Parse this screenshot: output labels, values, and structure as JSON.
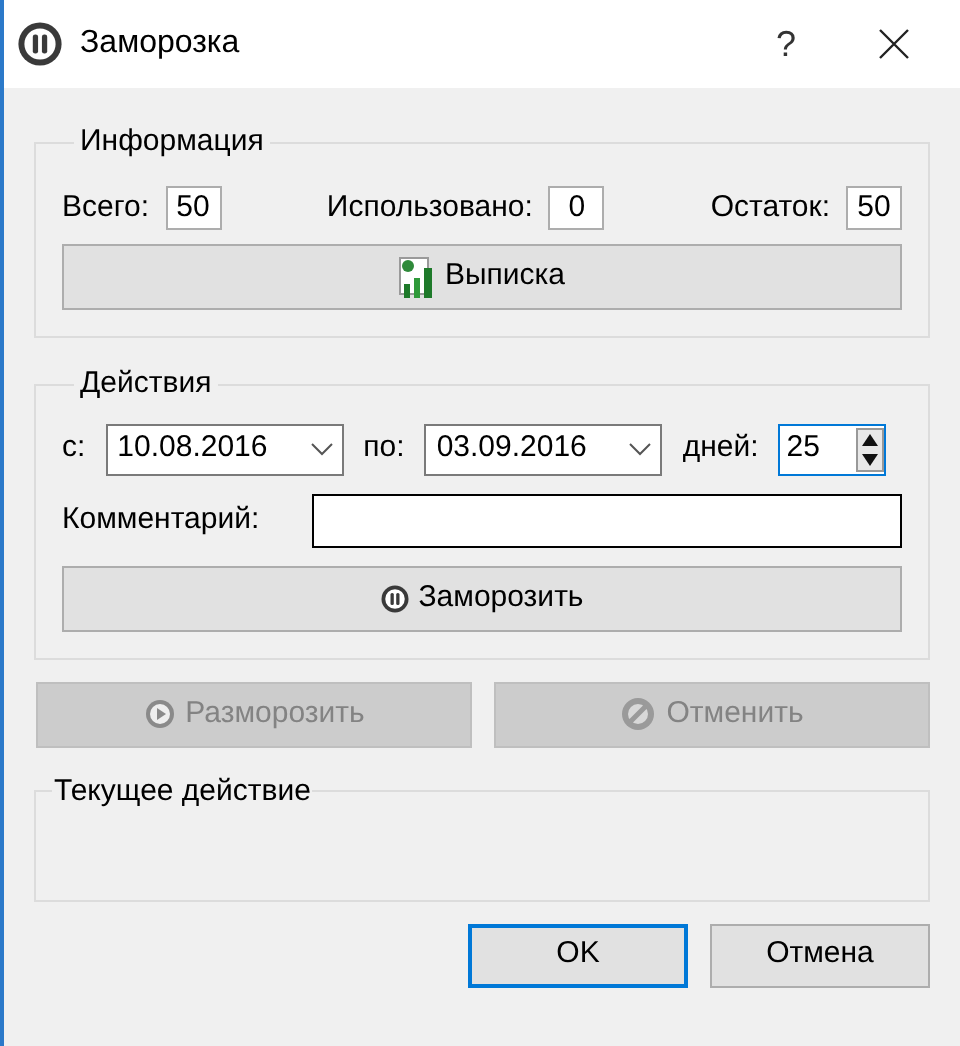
{
  "window": {
    "title": "Заморозка",
    "help": "?"
  },
  "info": {
    "title": "Информация",
    "stats": [
      {
        "label": "Всего:",
        "value": "50"
      },
      {
        "label": "Использовано:",
        "value": "0"
      },
      {
        "label": "Остаток:",
        "value": "50"
      }
    ],
    "statement_button": "Выписка"
  },
  "actions": {
    "title": "Действия",
    "from_label": "с:",
    "from": "10.08.2016",
    "to_label": "по:",
    "to": "03.09.2016",
    "days_label": "дней:",
    "days": {
      "value": "25",
      "focused": true
    },
    "comment_label": "Комментарий:",
    "freeze_button": "Заморозить"
  },
  "state_buttons": [
    {
      "label": "Разморозить",
      "kind": "unfreeze",
      "disabled": true
    },
    {
      "label": "Отменить",
      "kind": "cancel",
      "disabled": true
    }
  ],
  "current": {
    "title": "Текущее действие"
  },
  "dialog_buttons": [
    {
      "label": "OK",
      "default": true
    },
    {
      "label": "Отмена",
      "default": false
    }
  ]
}
